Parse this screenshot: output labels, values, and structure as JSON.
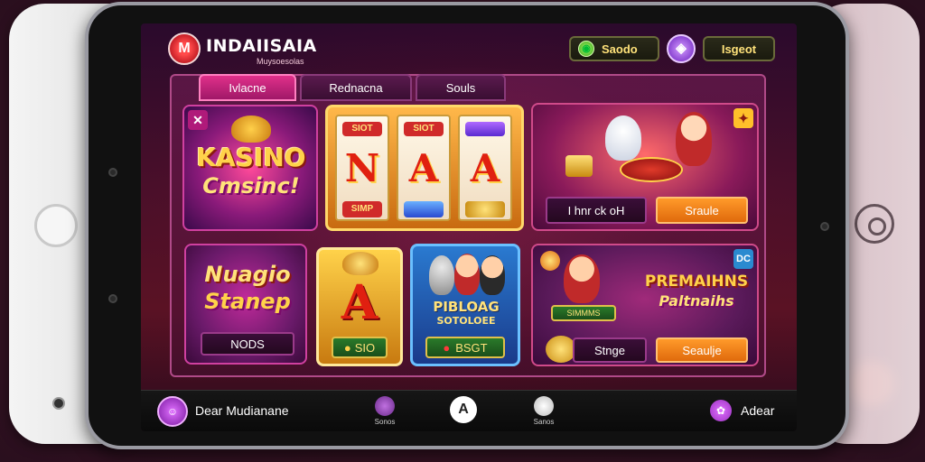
{
  "header": {
    "logo_mark": "M",
    "app_title": "INDAIISAIA",
    "app_subtitle": "Muysoesolas",
    "balance_label": "Saodo",
    "balance_icon": "coin-icon",
    "gem_icon": "gem-icon",
    "right_label": "Isgeot"
  },
  "tabs": [
    {
      "label": "Ivlacne",
      "active": true
    },
    {
      "label": "Rednacna",
      "active": false
    },
    {
      "label": "Souls",
      "active": false
    }
  ],
  "cards": {
    "kasino": {
      "line1": "KASINO",
      "line2": "Cmsinc!",
      "badge": "✕"
    },
    "slot": {
      "top_labels": [
        "SIOT",
        "SIOT",
        ""
      ],
      "symbols": [
        "N",
        "A",
        "A"
      ],
      "bottom_labels": [
        "SIMP",
        "",
        ""
      ]
    },
    "promo_top": {
      "left_button": "I hnr ck oH",
      "right_button": "Sraule",
      "badge": "✦"
    },
    "stamp": {
      "line1": "Nuagio",
      "line2": "Stanep",
      "button": "NODS"
    },
    "gold": {
      "symbol": "A",
      "button": "SIO"
    },
    "people": {
      "line1": "PIBLOAG",
      "line2": "SOTOLOEE",
      "button": "BSGT"
    },
    "premium": {
      "line1": "PREMAIHNS",
      "line2": "Paltnaihs",
      "badge": "DC",
      "left_button": "Stnge",
      "right_button": "Seaulje",
      "banner": "SIMMMS"
    }
  },
  "bottom_nav": {
    "left_label": "Dear Mudianane",
    "item2_sub": "Sonos",
    "center_label": "A",
    "item4_sub": "Sanos",
    "right_label": "Adear"
  },
  "colors": {
    "accent_pink": "#e0308a",
    "accent_orange": "#ff9a2a",
    "gold": "#ffd24a"
  }
}
